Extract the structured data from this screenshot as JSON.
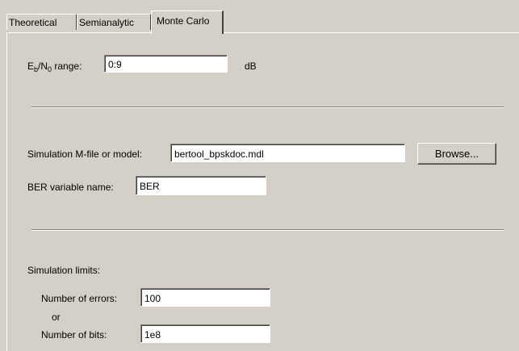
{
  "tabs": [
    {
      "label": "Theoretical",
      "active": false
    },
    {
      "label": "Semianalytic",
      "active": false
    },
    {
      "label": "Monte Carlo",
      "active": true
    }
  ],
  "ebno": {
    "label_prefix": "E",
    "label_sub1": "b",
    "label_mid": "/N",
    "label_sub2": "0",
    "label_suffix": " range:",
    "value": "0:9",
    "unit": "dB"
  },
  "simulation": {
    "model_label": "Simulation M-file or model:",
    "model_value": "bertool_bpskdoc.mdl",
    "browse_label": "Browse...",
    "ber_label": "BER variable name:",
    "ber_value": "BER"
  },
  "limits": {
    "heading": "Simulation limits:",
    "errors_label": "Number of errors:",
    "errors_value": "100",
    "or_label": "or",
    "bits_label": "Number of bits:",
    "bits_value": "1e8"
  },
  "colors": {
    "background": "#d4d0c8",
    "field": "#ffffff"
  }
}
